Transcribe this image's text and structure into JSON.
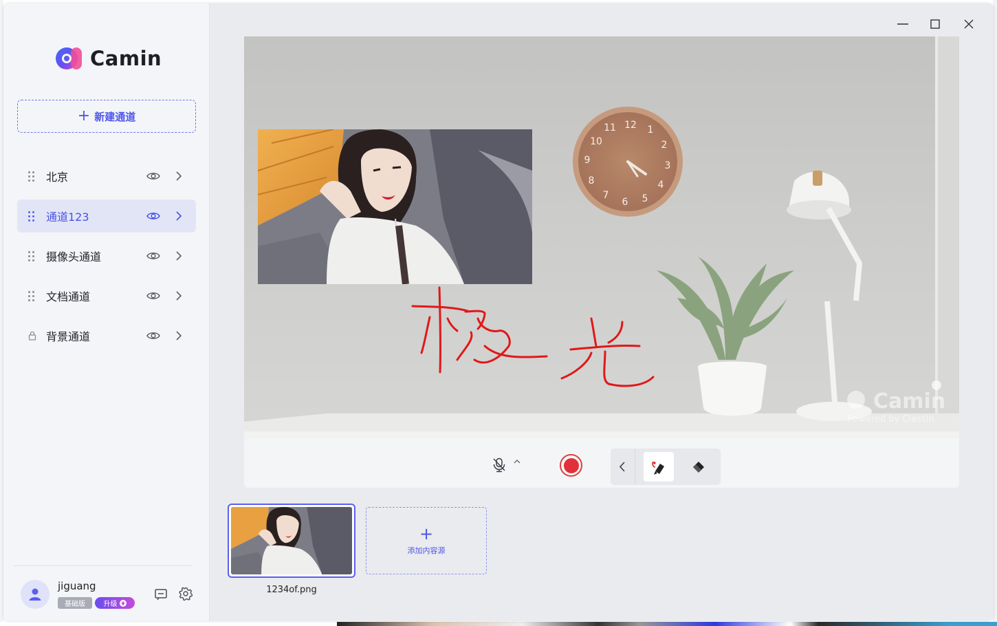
{
  "app": {
    "name": "Camin",
    "brand_color": "#4f57e8"
  },
  "sidebar": {
    "new_channel_label": "新建通道",
    "channels": [
      {
        "label": "北京",
        "icon": "drag-handle-icon",
        "active": false
      },
      {
        "label": "通道123",
        "icon": "drag-handle-icon",
        "active": true
      },
      {
        "label": "摄像头通道",
        "icon": "drag-handle-icon",
        "active": false
      },
      {
        "label": "文档通道",
        "icon": "drag-handle-icon",
        "active": false
      },
      {
        "label": "背景通道",
        "icon": "lock-icon",
        "active": false
      }
    ]
  },
  "user": {
    "name": "jiguang",
    "plan_badge": "基础版",
    "upgrade_badge": "升级"
  },
  "preview": {
    "handwriting": "极光",
    "watermark_brand": "Camin",
    "watermark_sub": "Powered by ClassIn"
  },
  "controls": {
    "record_color": "#e2303a",
    "tools": [
      "back-icon",
      "pen-icon",
      "eraser-icon"
    ],
    "active_tool": "pen"
  },
  "sources": {
    "items": [
      {
        "label": "1234of.png",
        "selected": true
      }
    ],
    "add_label": "添加内容源"
  }
}
